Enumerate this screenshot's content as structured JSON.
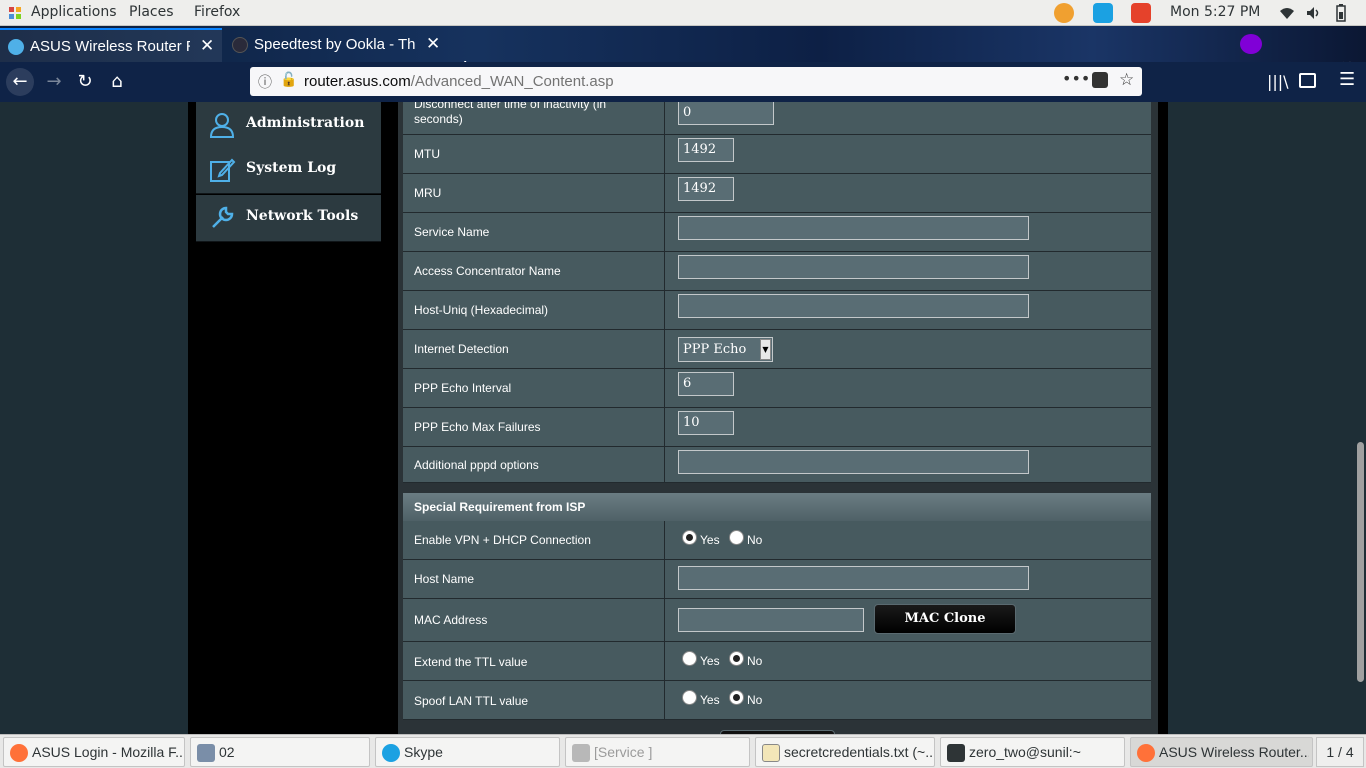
{
  "topbar": {
    "applications": "Applications",
    "places": "Places",
    "firefox": "Firefox",
    "clock": "Mon  5:27 PM",
    "indicators": [
      "wifi-icon",
      "volume-icon",
      "battery-icon"
    ]
  },
  "browser": {
    "tabs": [
      {
        "title": "ASUS Wireless Router R",
        "active": true
      },
      {
        "title": "Speedtest by Ookla - The",
        "active": false
      }
    ],
    "url_host": "router.asus.com",
    "url_path": "/Advanced_WAN_Content.asp"
  },
  "sidebar": {
    "items": [
      {
        "label": "Administration",
        "icon": "user-icon"
      },
      {
        "label": "System Log",
        "icon": "edit-log-icon"
      },
      {
        "label": "Network Tools",
        "icon": "wrench-icon"
      }
    ]
  },
  "form": {
    "rows": [
      {
        "label": "Disconnect after time of inactivity (in seconds)",
        "value": "0"
      },
      {
        "label": "MTU",
        "value": "1492"
      },
      {
        "label": "MRU",
        "value": "1492"
      },
      {
        "label": "Service Name",
        "value": ""
      },
      {
        "label": "Access Concentrator Name",
        "value": ""
      },
      {
        "label": "Host-Uniq (Hexadecimal)",
        "value": ""
      },
      {
        "label": "Internet Detection",
        "value": "PPP Echo"
      },
      {
        "label": "PPP Echo Interval",
        "value": "6"
      },
      {
        "label": "PPP Echo Max Failures",
        "value": "10"
      },
      {
        "label": "Additional pppd options",
        "value": ""
      }
    ],
    "section_title": "Special Requirement from ISP",
    "isp_rows": [
      {
        "label": "Enable VPN + DHCP Connection",
        "selected": "Yes"
      },
      {
        "label": "Host Name",
        "value": ""
      },
      {
        "label": "MAC Address",
        "value": "",
        "button": "MAC Clone"
      },
      {
        "label": "Extend the TTL value",
        "selected": "No"
      },
      {
        "label": "Spoof LAN TTL value",
        "selected": "No"
      }
    ],
    "yes": "Yes",
    "no": "No"
  },
  "taskbar": {
    "items": [
      {
        "label": "ASUS Login - Mozilla F..."
      },
      {
        "label": "02"
      },
      {
        "label": "Skype"
      },
      {
        "label": "[Service ]"
      },
      {
        "label": "secretcredentials.txt (~..."
      },
      {
        "label": "zero_two@sunil:~"
      },
      {
        "label": "ASUS Wireless Router..."
      }
    ],
    "pager": "1 / 4"
  },
  "colors": {
    "row_bg": "#475a5f",
    "content_bg": "#2b3337",
    "accent": "#4fb0e8"
  }
}
